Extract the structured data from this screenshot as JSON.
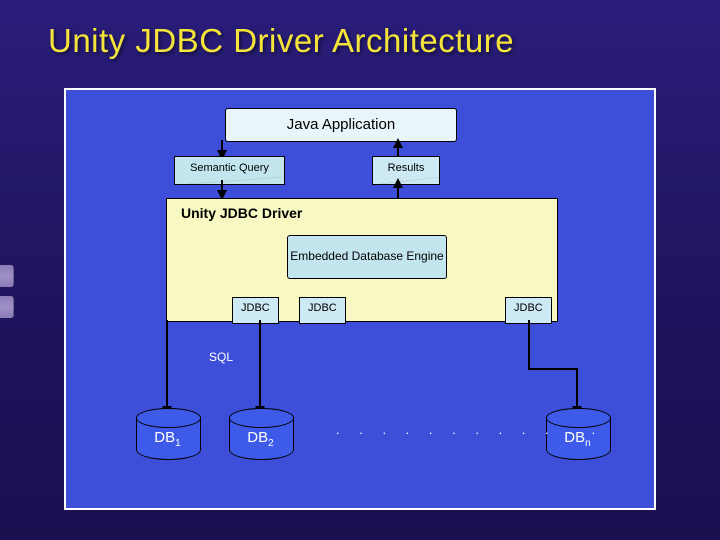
{
  "title": "Unity JDBC Driver Architecture",
  "java_app": "Java Application",
  "semantic_query": "Semantic Query",
  "results": "Results",
  "driver_title": "Unity JDBC Driver",
  "embedded_engine": "Embedded Database Engine",
  "jdbc": {
    "a": "JDBC",
    "b": "JDBC",
    "c": "JDBC"
  },
  "sql": "SQL",
  "db": {
    "a": "DB",
    "a_sub": "1",
    "b": "DB",
    "b_sub": "2",
    "n": "DB",
    "n_sub": "n"
  },
  "dots": ". . . . . . . . . . . ."
}
